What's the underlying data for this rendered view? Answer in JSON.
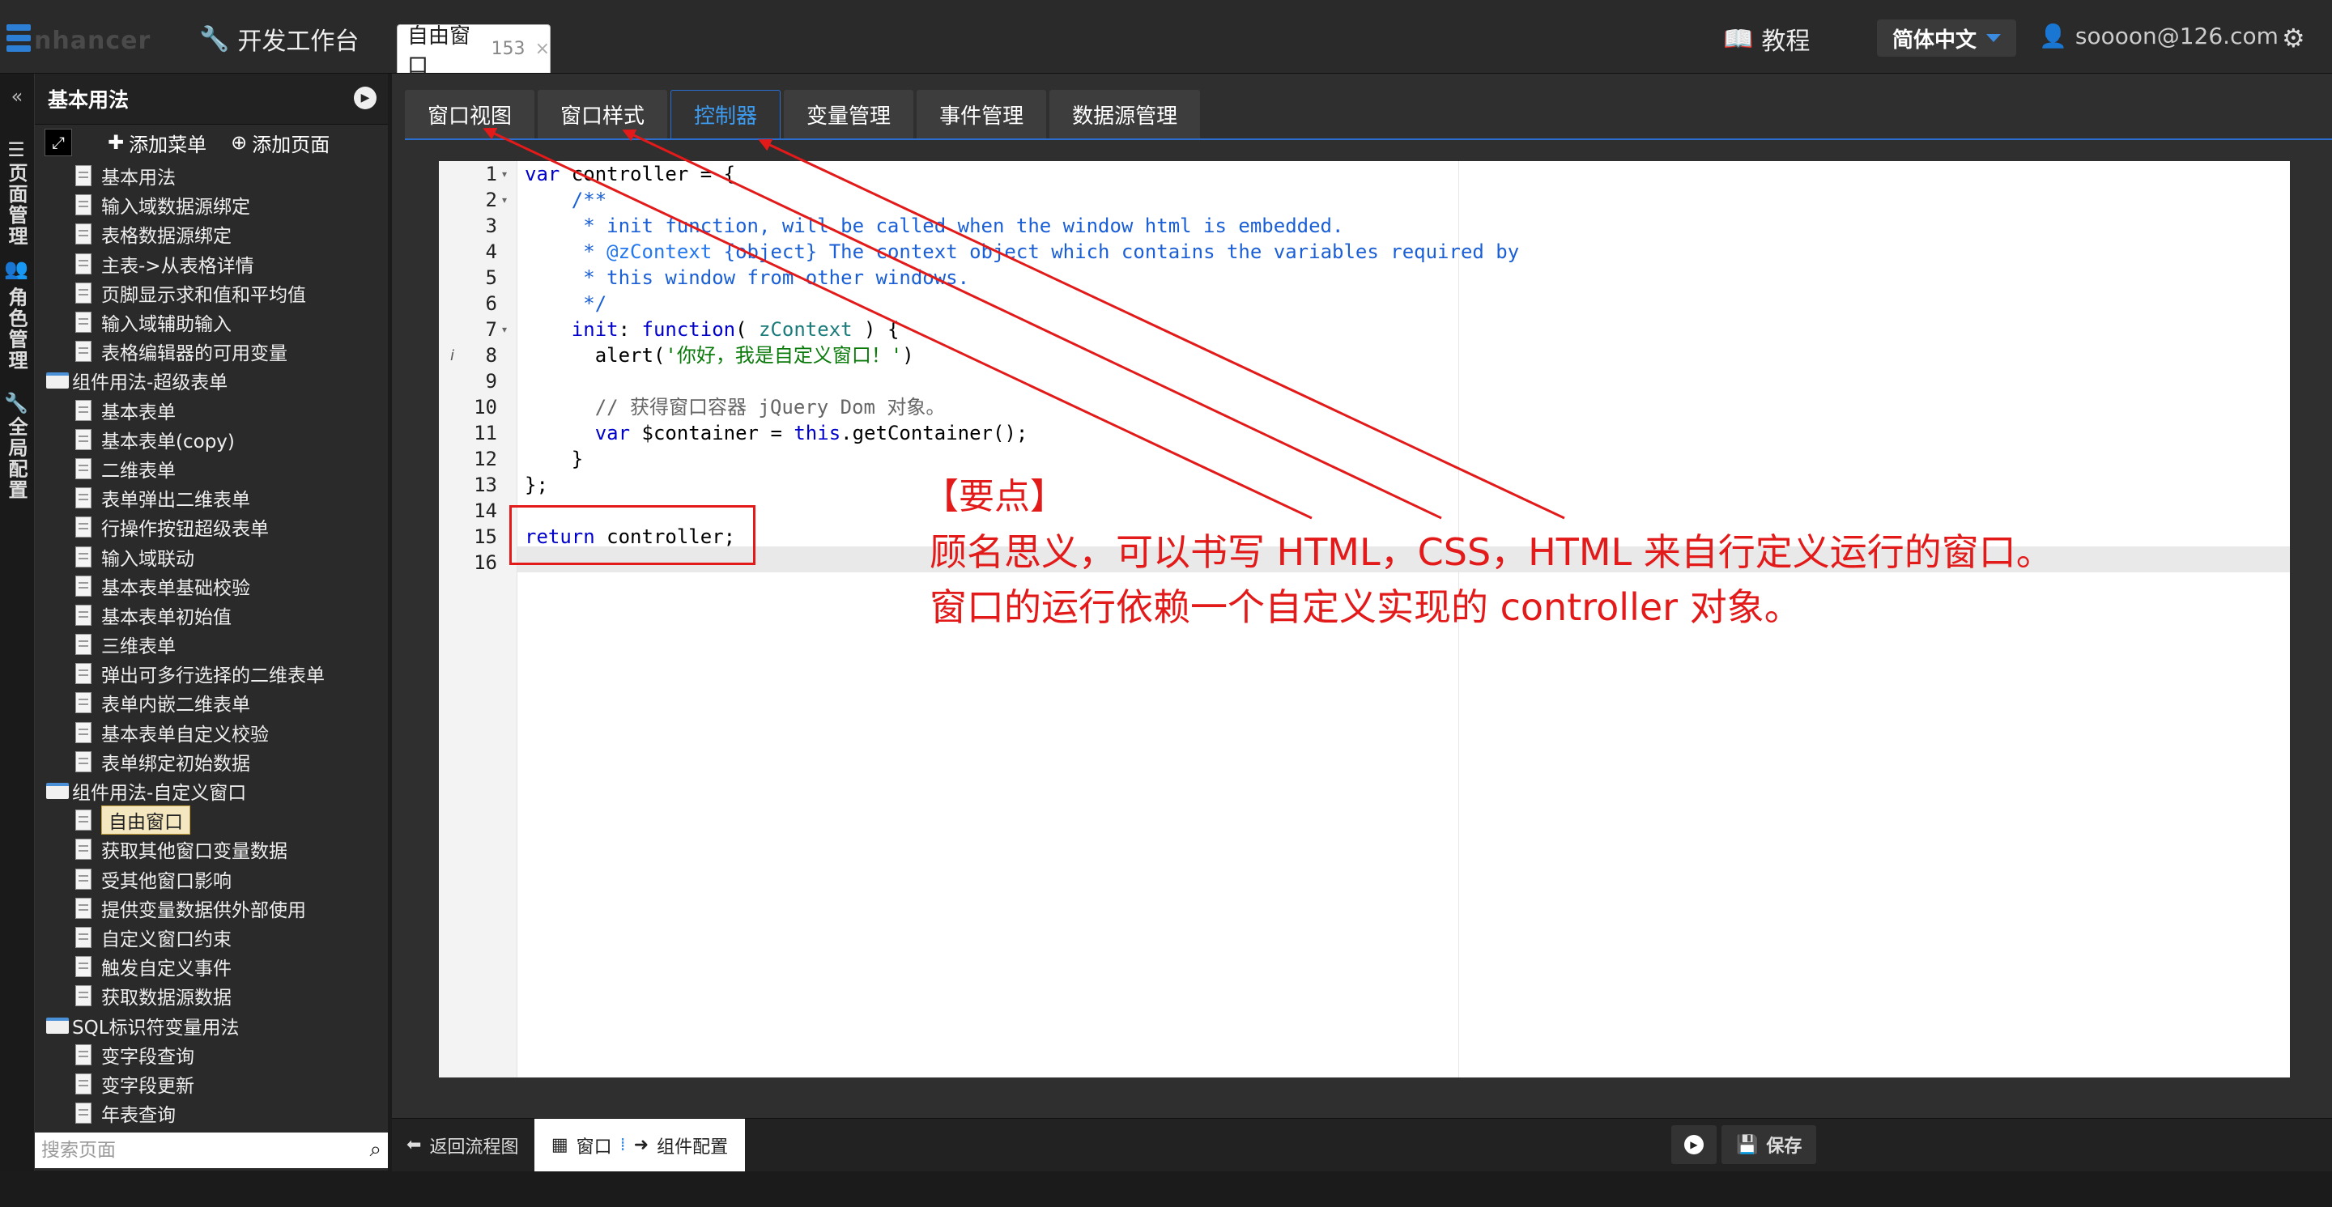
{
  "topbar": {
    "logo_text": "nhancer",
    "workbench": "开发工作台",
    "window_tab": {
      "label": "自由窗口",
      "id": "153",
      "close": "×"
    },
    "tutorial": "教程",
    "language": "简体中文",
    "user": "soooon@126.com"
  },
  "rail": {
    "collapse": "«",
    "tabs": [
      "页面管理",
      "角色管理",
      "全局配置"
    ]
  },
  "sidebar": {
    "title": "基本用法",
    "add_menu": "添加菜单",
    "add_page": "添加页面",
    "search_placeholder": "搜索页面",
    "tree": [
      {
        "label": "基本用法",
        "type": "leaf"
      },
      {
        "label": "输入域数据源绑定",
        "type": "leaf"
      },
      {
        "label": "表格数据源绑定",
        "type": "leaf"
      },
      {
        "label": "主表->从表格详情",
        "type": "leaf"
      },
      {
        "label": "页脚显示求和值和平均值",
        "type": "leaf"
      },
      {
        "label": "输入域辅助输入",
        "type": "leaf"
      },
      {
        "label": "表格编辑器的可用变量",
        "type": "leaf"
      },
      {
        "label": "组件用法-超级表单",
        "type": "folder"
      },
      {
        "label": "基本表单",
        "type": "leaf"
      },
      {
        "label": "基本表单(copy)",
        "type": "leaf"
      },
      {
        "label": "二维表单",
        "type": "leaf"
      },
      {
        "label": "表单弹出二维表单",
        "type": "leaf"
      },
      {
        "label": "行操作按钮超级表单",
        "type": "leaf"
      },
      {
        "label": "输入域联动",
        "type": "leaf"
      },
      {
        "label": "基本表单基础校验",
        "type": "leaf"
      },
      {
        "label": "基本表单初始值",
        "type": "leaf"
      },
      {
        "label": "三维表单",
        "type": "leaf"
      },
      {
        "label": "弹出可多行选择的二维表单",
        "type": "leaf"
      },
      {
        "label": "表单内嵌二维表单",
        "type": "leaf"
      },
      {
        "label": "基本表单自定义校验",
        "type": "leaf"
      },
      {
        "label": "表单绑定初始数据",
        "type": "leaf"
      },
      {
        "label": "组件用法-自定义窗口",
        "type": "folder"
      },
      {
        "label": "自由窗口",
        "type": "leaf",
        "selected": true
      },
      {
        "label": "获取其他窗口变量数据",
        "type": "leaf"
      },
      {
        "label": "受其他窗口影响",
        "type": "leaf"
      },
      {
        "label": "提供变量数据供外部使用",
        "type": "leaf"
      },
      {
        "label": "自定义窗口约束",
        "type": "leaf"
      },
      {
        "label": "触发自定义事件",
        "type": "leaf"
      },
      {
        "label": "获取数据源数据",
        "type": "leaf"
      },
      {
        "label": "SQL标识符变量用法",
        "type": "folder"
      },
      {
        "label": "变字段查询",
        "type": "leaf"
      },
      {
        "label": "变字段更新",
        "type": "leaf"
      },
      {
        "label": "年表查询",
        "type": "leaf"
      }
    ]
  },
  "main": {
    "tabs": [
      {
        "label": "窗口视图",
        "active": false
      },
      {
        "label": "窗口样式",
        "active": false
      },
      {
        "label": "控制器",
        "active": true
      },
      {
        "label": "变量管理",
        "active": false
      },
      {
        "label": "事件管理",
        "active": false
      },
      {
        "label": "数据源管理",
        "active": false
      }
    ],
    "line_numbers": [
      "1",
      "2",
      "3",
      "4",
      "5",
      "6",
      "7",
      "8",
      "9",
      "10",
      "11",
      "12",
      "13",
      "14",
      "15",
      "16"
    ],
    "code": [
      {
        "n": 1,
        "parts": [
          {
            "t": "var",
            "c": "kw"
          },
          {
            "t": " controller = {",
            "c": ""
          }
        ]
      },
      {
        "n": 2,
        "parts": [
          {
            "t": "    /**",
            "c": "cm"
          }
        ]
      },
      {
        "n": 3,
        "parts": [
          {
            "t": "     * init function, will be called when the window html is embedded.",
            "c": "cm"
          }
        ]
      },
      {
        "n": 4,
        "parts": [
          {
            "t": "     * ",
            "c": "cm"
          },
          {
            "t": "@zContext",
            "c": "cm2"
          },
          {
            "t": " {object} The context object which contains the variables required by",
            "c": "cm"
          }
        ]
      },
      {
        "n": 5,
        "parts": [
          {
            "t": "     * this window from other windows.",
            "c": "cm"
          }
        ]
      },
      {
        "n": 6,
        "parts": [
          {
            "t": "     */",
            "c": "cm"
          }
        ]
      },
      {
        "n": 7,
        "parts": [
          {
            "t": "    init",
            "c": "kw"
          },
          {
            "t": ": ",
            "c": ""
          },
          {
            "t": "function",
            "c": "kw"
          },
          {
            "t": "( ",
            "c": ""
          },
          {
            "t": "zContext",
            "c": "zc"
          },
          {
            "t": " ) {",
            "c": ""
          }
        ]
      },
      {
        "n": 8,
        "parts": [
          {
            "t": "      alert(",
            "c": ""
          },
          {
            "t": "'你好，我是自定义窗口！'",
            "c": "str"
          },
          {
            "t": ")",
            "c": ""
          }
        ]
      },
      {
        "n": 9,
        "parts": [
          {
            "t": "",
            "c": ""
          }
        ]
      },
      {
        "n": 10,
        "parts": [
          {
            "t": "      // 获得窗口容器 jQuery Dom 对象。",
            "c": "gl"
          }
        ]
      },
      {
        "n": 11,
        "parts": [
          {
            "t": "      ",
            "c": ""
          },
          {
            "t": "var",
            "c": "kw"
          },
          {
            "t": " $container = ",
            "c": ""
          },
          {
            "t": "this",
            "c": "kw"
          },
          {
            "t": ".getContainer();",
            "c": ""
          }
        ]
      },
      {
        "n": 12,
        "parts": [
          {
            "t": "    }",
            "c": ""
          }
        ]
      },
      {
        "n": 13,
        "parts": [
          {
            "t": "};",
            "c": ""
          }
        ]
      },
      {
        "n": 14,
        "parts": [
          {
            "t": "",
            "c": ""
          }
        ]
      },
      {
        "n": 15,
        "parts": [
          {
            "t": "return",
            "c": "kw"
          },
          {
            "t": " controller;",
            "c": ""
          }
        ]
      },
      {
        "n": 16,
        "parts": [
          {
            "t": "",
            "c": ""
          }
        ]
      }
    ],
    "note": {
      "title": "【要点】",
      "line1": "顾名思义，可以书写 HTML，CSS，HTML 来自行定义运行的窗口。",
      "line2": "窗口的运行依赖一个自定义实现的 controller 对象。"
    }
  },
  "bottom": {
    "back": "返回流程图",
    "window": "窗口",
    "component_config": "组件配置",
    "save": "保存"
  },
  "colors": {
    "accent": "#2a6ed0",
    "annotation": "#e31a1a"
  }
}
